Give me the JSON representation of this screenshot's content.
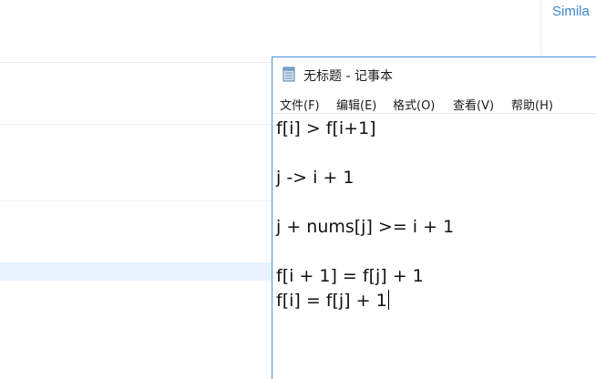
{
  "background_page": {
    "similar_link": "Simila"
  },
  "notepad": {
    "title": "无标题 - 记事本",
    "menu": [
      {
        "label": "文件(F)"
      },
      {
        "label": "编辑(E)"
      },
      {
        "label": "格式(O)"
      },
      {
        "label": "查看(V)"
      },
      {
        "label": "帮助(H)"
      }
    ],
    "lines": [
      "f[i] > f[i+1]",
      "",
      "j -> i + 1",
      "",
      "j + nums[j] >= i + 1",
      "",
      "f[i + 1] = f[j] + 1",
      "f[i] = f[j] + 1"
    ]
  },
  "colors": {
    "link": "#3a87c7",
    "window_border": "#4a8fd8",
    "highlight_row": "#e8f2fd"
  }
}
